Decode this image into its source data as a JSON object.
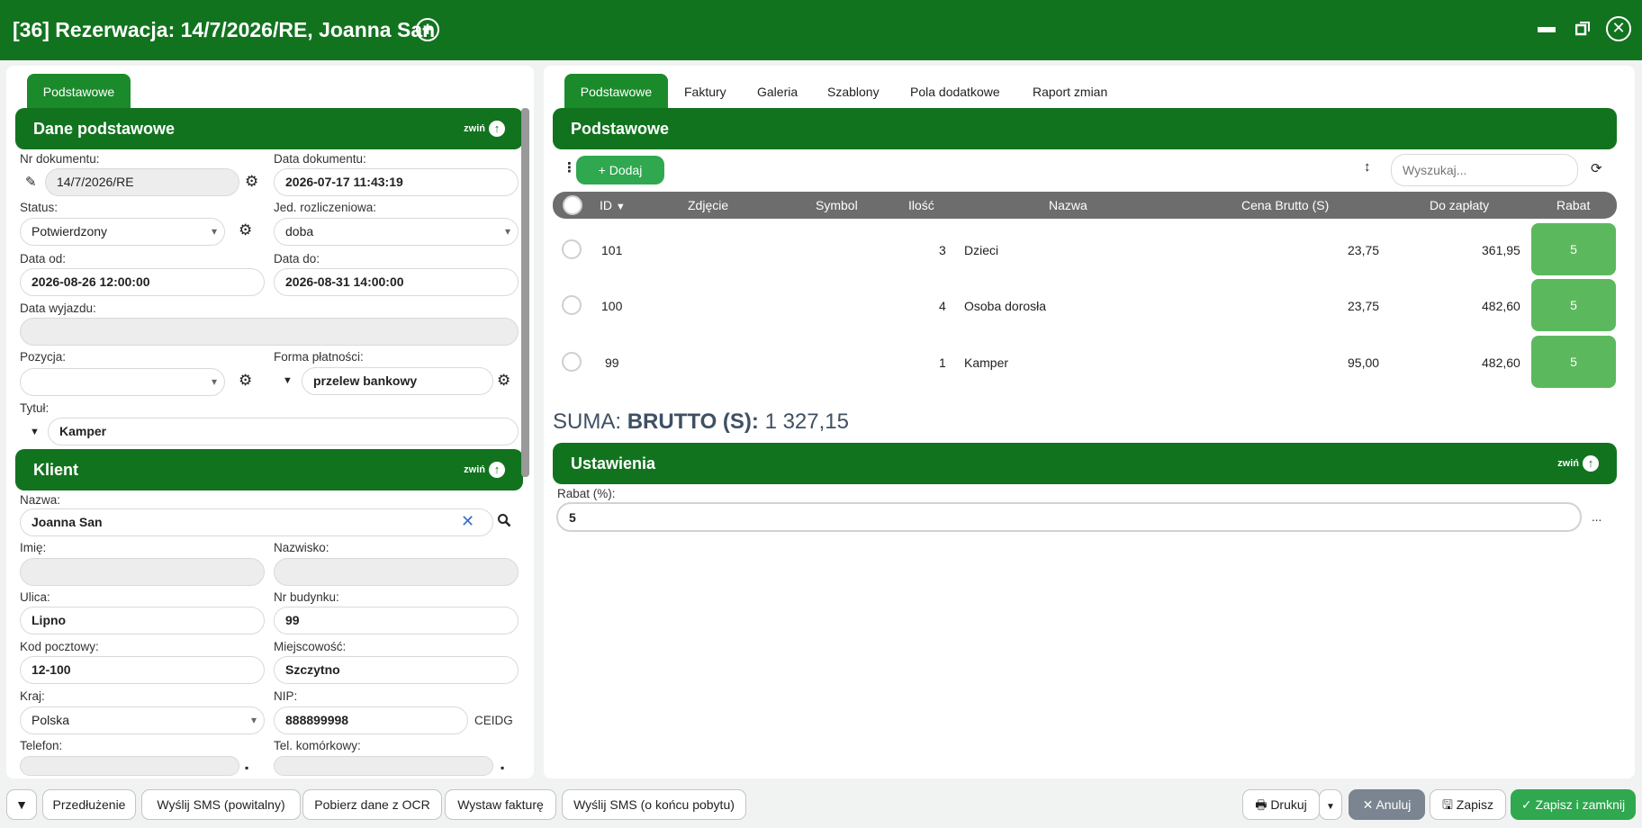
{
  "window": {
    "title": "[36] Rezerwacja: 14/7/2026/RE, Joanna San",
    "minimize_icon": "minus-icon",
    "restore_icon": "restore-icon",
    "close_icon": "close-icon"
  },
  "left": {
    "tab": "Podstawowe",
    "collapse_label": "zwiń",
    "basic": {
      "title": "Dane podstawowe",
      "nr_label": "Nr dokumentu:",
      "nr_value": "14/7/2026/RE",
      "date_doc_label": "Data dokumentu:",
      "date_doc_value": "2026-07-17 11:43:19",
      "status_label": "Status:",
      "status_value": "Potwierdzony",
      "unit_label": "Jed. rozliczeniowa:",
      "unit_value": "doba",
      "date_from_label": "Data od:",
      "date_from_value": "2026-08-26 12:00:00",
      "date_to_label": "Data do:",
      "date_to_value": "2026-08-31 14:00:00",
      "departure_label": "Data wyjazdu:",
      "departure_value": "",
      "position_label": "Pozycja:",
      "position_value": "",
      "payment_label": "Forma płatności:",
      "payment_value": "przelew bankowy",
      "title_label": "Tytuł:",
      "title_value": "Kamper"
    },
    "client": {
      "title": "Klient",
      "name_label": "Nazwa:",
      "name_value": "Joanna San",
      "first_label": "Imię:",
      "first_value": "",
      "last_label": "Nazwisko:",
      "last_value": "",
      "street_label": "Ulica:",
      "street_value": "Lipno",
      "building_label": "Nr budynku:",
      "building_value": "99",
      "zip_label": "Kod pocztowy:",
      "zip_value": "12-100",
      "city_label": "Miejscowość:",
      "city_value": "Szczytno",
      "country_label": "Kraj:",
      "country_value": "Polska",
      "nip_label": "NIP:",
      "nip_value": "888899998",
      "ceidg_label": "CEIDG",
      "phone_label": "Telefon:",
      "mobile_label": "Tel. komórkowy:"
    }
  },
  "right": {
    "tabs": [
      "Podstawowe",
      "Faktury",
      "Galeria",
      "Szablony",
      "Pola dodatkowe",
      "Raport zmian"
    ],
    "section_title": "Podstawowe",
    "add_label": "+ Dodaj",
    "search_placeholder": "Wyszukaj...",
    "columns": [
      "ID",
      "Zdjęcie",
      "Symbol",
      "Ilość",
      "Nazwa",
      "Cena Brutto (S)",
      "Do zapłaty",
      "Rabat"
    ],
    "rows": [
      {
        "id": "101",
        "qty": "3",
        "name": "Dzieci",
        "price": "23,75",
        "total": "361,95",
        "rabat": "5"
      },
      {
        "id": "100",
        "qty": "4",
        "name": "Osoba dorosła",
        "price": "23,75",
        "total": "482,60",
        "rabat": "5"
      },
      {
        "id": "99",
        "qty": "1",
        "name": "Kamper",
        "price": "95,00",
        "total": "482,60",
        "rabat": "5"
      }
    ],
    "sum_prefix": "SUMA:",
    "sum_label": "BRUTTO (S):",
    "sum_value": "1 327,15",
    "settings_title": "Ustawienia",
    "collapse_label": "zwiń",
    "rabat_label": "Rabat (%):",
    "rabat_value": "5",
    "more_label": "..."
  },
  "footer": {
    "extension": "Przedłużenie",
    "sms_welcome": "Wyślij SMS (powitalny)",
    "ocr": "Pobierz dane z OCR",
    "invoice": "Wystaw fakturę",
    "sms_end": "Wyślij SMS (o końcu pobytu)",
    "print": "Drukuj",
    "cancel": "Anuluj",
    "save": "Zapisz",
    "save_close": "Zapisz i zamknij"
  }
}
